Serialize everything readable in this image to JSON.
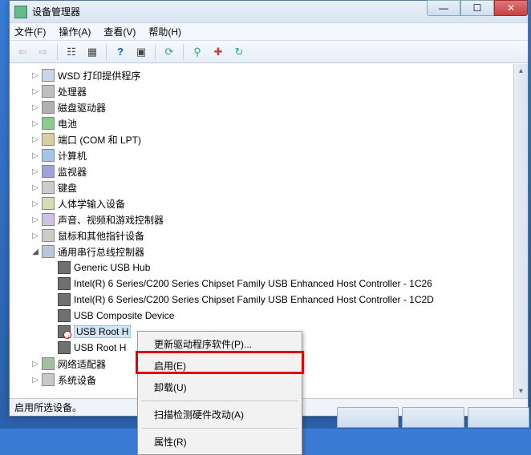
{
  "window": {
    "title": "设备管理器"
  },
  "menubar": {
    "file": "文件(F)",
    "action": "操作(A)",
    "view": "查看(V)",
    "help": "帮助(H)"
  },
  "toolbar_icons": {
    "back": "⇦",
    "forward": "⇨",
    "tree": "☷",
    "props": "▦",
    "help": "?",
    "stop": "▣",
    "refresh": "⟳",
    "scan": "⚲",
    "extra1": "✚",
    "extra2": "↻"
  },
  "tree": {
    "items": [
      {
        "label": "WSD 打印提供程序",
        "exp": "closed",
        "icon": "printer",
        "depth": 1
      },
      {
        "label": "处理器",
        "exp": "closed",
        "icon": "cpu",
        "depth": 1
      },
      {
        "label": "磁盘驱动器",
        "exp": "closed",
        "icon": "disk",
        "depth": 1
      },
      {
        "label": "电池",
        "exp": "closed",
        "icon": "battery",
        "depth": 1
      },
      {
        "label": "端口 (COM 和 LPT)",
        "exp": "closed",
        "icon": "port",
        "depth": 1
      },
      {
        "label": "计算机",
        "exp": "closed",
        "icon": "computer",
        "depth": 1
      },
      {
        "label": "监视器",
        "exp": "closed",
        "icon": "monitor",
        "depth": 1
      },
      {
        "label": "键盘",
        "exp": "closed",
        "icon": "keyboard",
        "depth": 1
      },
      {
        "label": "人体学输入设备",
        "exp": "closed",
        "icon": "hid",
        "depth": 1
      },
      {
        "label": "声音、视频和游戏控制器",
        "exp": "closed",
        "icon": "sound",
        "depth": 1
      },
      {
        "label": "鼠标和其他指针设备",
        "exp": "closed",
        "icon": "mouse",
        "depth": 1
      },
      {
        "label": "通用串行总线控制器",
        "exp": "open",
        "icon": "usb",
        "depth": 1
      },
      {
        "label": "Generic USB Hub",
        "exp": "none",
        "icon": "usbdev",
        "depth": 2
      },
      {
        "label": "Intel(R) 6 Series/C200 Series Chipset Family USB Enhanced Host Controller - 1C26",
        "exp": "none",
        "icon": "usbdev",
        "depth": 2
      },
      {
        "label": "Intel(R) 6 Series/C200 Series Chipset Family USB Enhanced Host Controller - 1C2D",
        "exp": "none",
        "icon": "usbdev",
        "depth": 2
      },
      {
        "label": "USB Composite Device",
        "exp": "none",
        "icon": "usbdev",
        "depth": 2
      },
      {
        "label": "USB Root H",
        "exp": "none",
        "icon": "usbdev disabled",
        "depth": 2,
        "selected": true
      },
      {
        "label": "USB Root H",
        "exp": "none",
        "icon": "usbdev",
        "depth": 2
      },
      {
        "label": "网络适配器",
        "exp": "closed",
        "icon": "net",
        "depth": 1
      },
      {
        "label": "系统设备",
        "exp": "closed",
        "icon": "sys",
        "depth": 1
      }
    ]
  },
  "context_menu": {
    "update_driver": "更新驱动程序软件(P)...",
    "enable": "启用(E)",
    "uninstall": "卸载(U)",
    "scan_hw": "扫描检测硬件改动(A)",
    "properties": "属性(R)"
  },
  "statusbar": {
    "text": "启用所选设备。"
  }
}
